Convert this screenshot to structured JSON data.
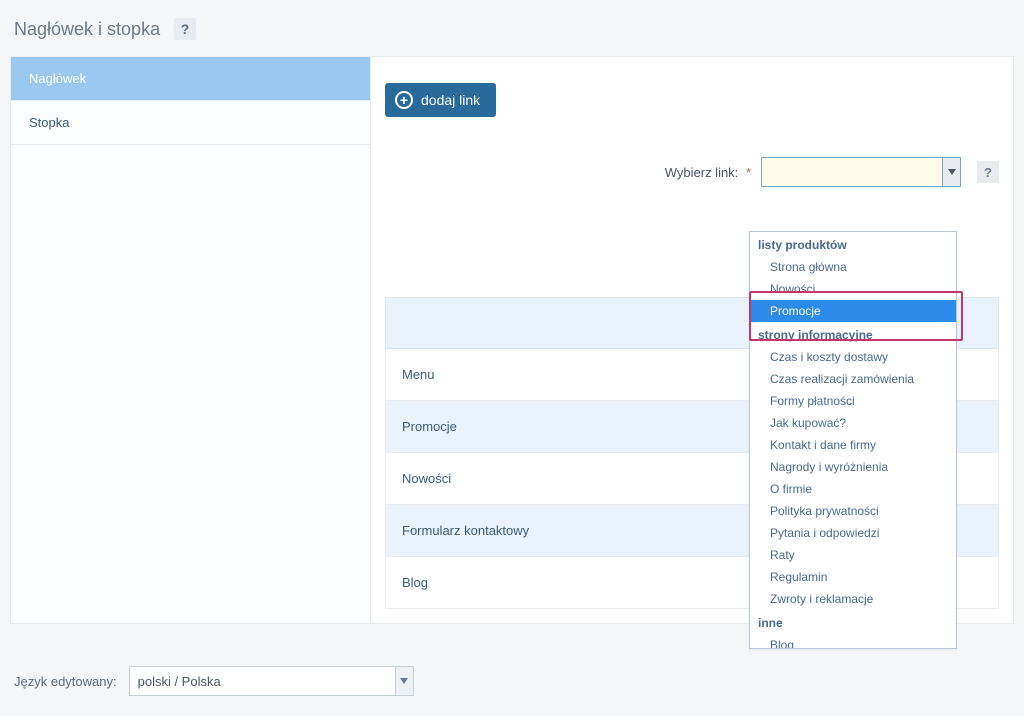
{
  "page": {
    "title": "Nagłówek i stopka"
  },
  "sidebar": {
    "items": [
      {
        "label": "Nagłówek",
        "active": true
      },
      {
        "label": "Stopka",
        "active": false
      }
    ]
  },
  "toolbar": {
    "add_link_label": "dodaj link"
  },
  "link_field": {
    "label": "Wybierz link:",
    "required_mark": "*"
  },
  "dropdown": {
    "groups": [
      {
        "label": "listy produktów",
        "items": [
          {
            "label": "Strona główna"
          },
          {
            "label": "Nowości",
            "boxed": true
          },
          {
            "label": "Promocje",
            "hover": true,
            "boxed": true
          }
        ]
      },
      {
        "label": "strony informacyjne",
        "items": [
          {
            "label": "Czas i koszty dostawy"
          },
          {
            "label": "Czas realizacji zamówienia"
          },
          {
            "label": "Formy płatności"
          },
          {
            "label": "Jak kupować?"
          },
          {
            "label": "Kontakt i dane firmy"
          },
          {
            "label": "Nagrody i wyróżnienia"
          },
          {
            "label": "O firmie"
          },
          {
            "label": "Polityka prywatności"
          },
          {
            "label": "Pytania i odpowiedzi"
          },
          {
            "label": "Raty"
          },
          {
            "label": "Regulamin"
          },
          {
            "label": "Zwroty i reklamacje"
          }
        ]
      },
      {
        "label": "inne",
        "items": [
          {
            "label": "Blog"
          }
        ]
      }
    ]
  },
  "table": {
    "rows": [
      {
        "label": "Menu"
      },
      {
        "label": "Promocje"
      },
      {
        "label": "Nowości"
      },
      {
        "label": "Formularz kontaktowy"
      },
      {
        "label": "Blog"
      }
    ]
  },
  "footer": {
    "lang_label": "Język edytowany:",
    "lang_value": "polski / Polska"
  }
}
